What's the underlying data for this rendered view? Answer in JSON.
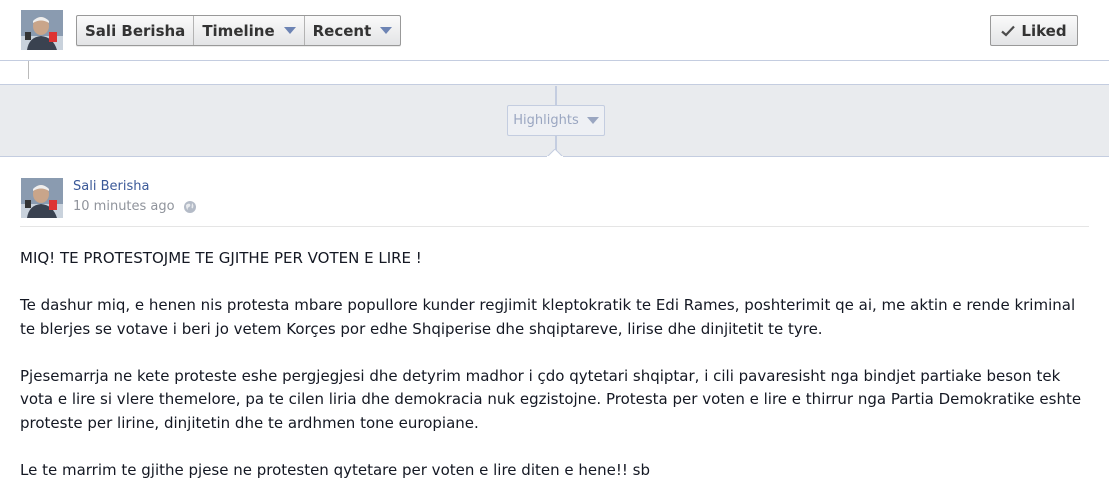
{
  "header": {
    "breadcrumbs": [
      {
        "label": "Sali Berisha",
        "has_caret": false
      },
      {
        "label": "Timeline",
        "has_caret": true
      },
      {
        "label": "Recent",
        "has_caret": true
      }
    ],
    "liked_label": "Liked"
  },
  "timeline": {
    "highlights_label": "Highlights"
  },
  "post": {
    "author": "Sali Berisha",
    "time": "10 minutes ago",
    "paragraphs": [
      "MIQ! TE PROTESTOJME TE GJITHE PER VOTEN E LIRE !",
      "Te dashur miq, e henen nis protesta mbare popullore kunder regjimit kleptokratik te Edi Rames, poshterimit qe ai, me aktin e rende kriminal te blerjes se votave i beri jo vetem Korçes por edhe Shqiperise dhe shqiptareve, lirise dhe dinjitetit te tyre.",
      "Pjesemarrja ne kete proteste eshe pergjegjesi dhe detyrim madhor i çdo qytetari shqiptar, i cili pavaresisht nga bindjet partiake beson tek vota e lire si vlere themelore, pa te cilen liria dhe demokracia nuk egzistojne. Protesta per voten e lire e thirrur nga Partia Demokratike eshte proteste per lirine, dinjitetin dhe te ardhmen tone europiane.",
      "Le te marrim te gjithe pjese ne protesten qytetare per voten e lire diten e hene!! sb"
    ]
  },
  "colors": {
    "link": "#3b5998",
    "background": "#e9ebee",
    "border": "#c4cde0"
  }
}
